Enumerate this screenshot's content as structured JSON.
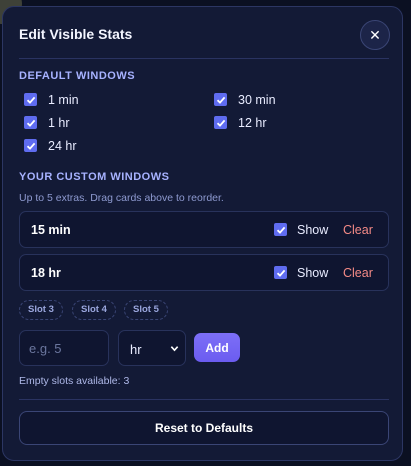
{
  "modal": {
    "title": "Edit Visible Stats",
    "close_icon": "close-icon",
    "close_glyph": "✕"
  },
  "default_windows": {
    "heading": "DEFAULT WINDOWS",
    "items": [
      {
        "label": "1 min",
        "checked": true
      },
      {
        "label": "30 min",
        "checked": true
      },
      {
        "label": "1 hr",
        "checked": true
      },
      {
        "label": "12 hr",
        "checked": true
      },
      {
        "label": "24 hr",
        "checked": true
      }
    ]
  },
  "custom_windows": {
    "heading": "YOUR CUSTOM WINDOWS",
    "hint": "Up to 5 extras. Drag cards above to reorder.",
    "cards": [
      {
        "label": "15 min",
        "show_label": "Show",
        "show_checked": true,
        "clear_label": "Clear"
      },
      {
        "label": "18 hr",
        "show_label": "Show",
        "show_checked": true,
        "clear_label": "Clear"
      }
    ],
    "slots": [
      "Slot 3",
      "Slot 4",
      "Slot 5"
    ]
  },
  "add_form": {
    "amount_placeholder": "e.g. 5",
    "unit_value": "hr",
    "add_label": "Add",
    "empty_slots_text": "Empty slots available: 3"
  },
  "footer": {
    "reset_label": "Reset to Defaults"
  },
  "colors": {
    "accent": "#5f6cf0",
    "clear": "#f48a86",
    "add_button": "#7366f4",
    "panel": "#131a36"
  }
}
